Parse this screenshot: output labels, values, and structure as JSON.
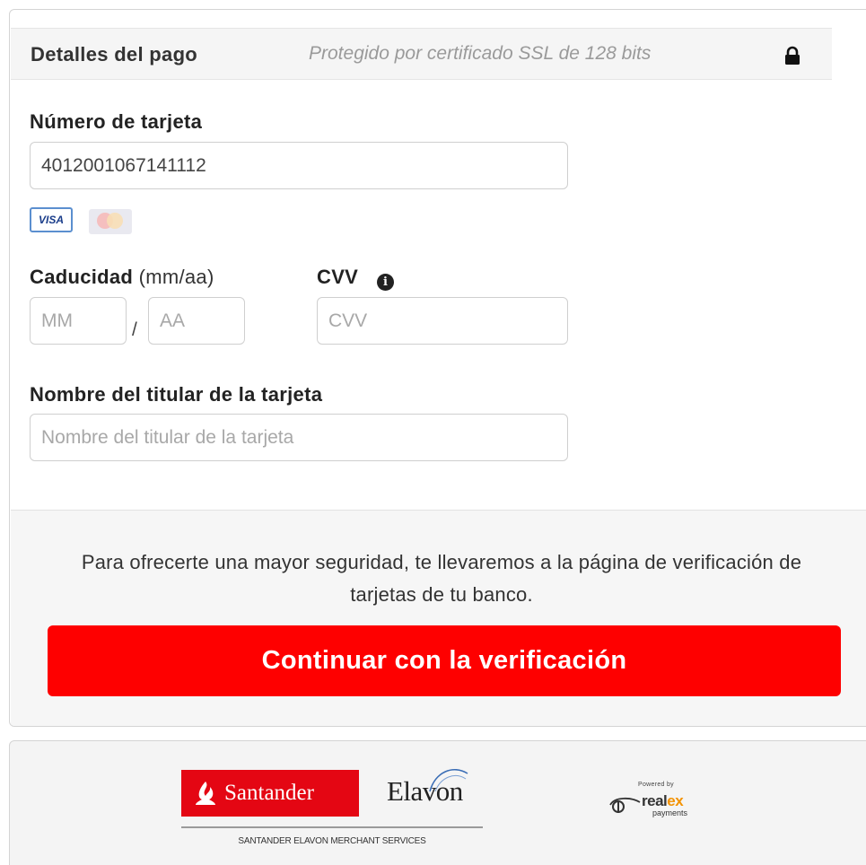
{
  "header": {
    "title": "Detalles del pago",
    "ssl_note": "Protegido por certificado SSL de 128 bits",
    "lock_icon": "lock-icon"
  },
  "card_number": {
    "label": "Número de tarjeta",
    "value": "4012001067141112"
  },
  "card_brands": {
    "visa_text": "VISA",
    "visa_selected": true,
    "mastercard_selected": false
  },
  "expiry": {
    "label": "Caducidad",
    "format_hint": "(mm/aa)",
    "month_placeholder": "MM",
    "separator": "/",
    "year_placeholder": "AA"
  },
  "cvv": {
    "label": "CVV",
    "placeholder": "CVV",
    "info_icon": "info-icon"
  },
  "cardholder": {
    "label": "Nombre del titular de la tarjeta",
    "placeholder": "Nombre del titular de la tarjeta"
  },
  "verification": {
    "notice": "Para ofrecerte una mayor seguridad, te llevaremos a la página de verificación de tarjetas de tu banco.",
    "button_label": "Continuar con la verificación",
    "button_color": "#fe0000"
  },
  "logos": {
    "santander": "Santander",
    "elavon": "Elavon",
    "merchant_services": "SANTANDER ELAVON MERCHANT SERVICES",
    "powered_by": "Powered by",
    "realex_name_a": "real",
    "realex_name_b": "ex",
    "realex_sub": "payments",
    "santander_color": "#e40613",
    "realex_accent": "#f39200"
  }
}
